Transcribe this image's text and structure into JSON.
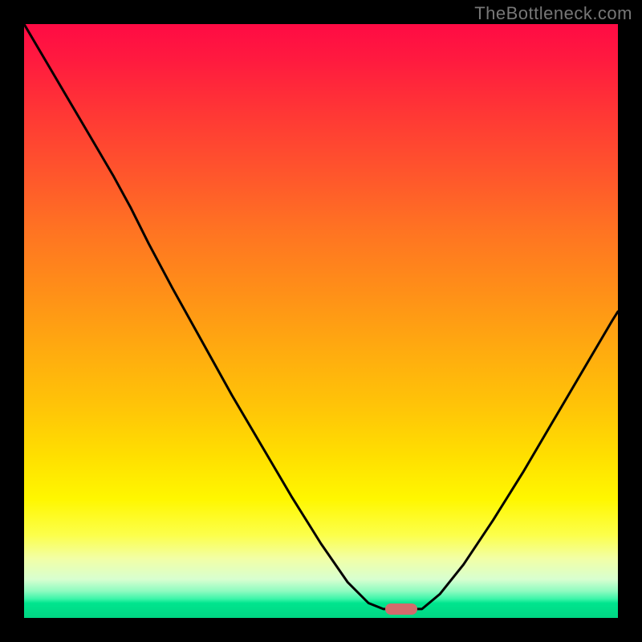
{
  "watermark": "TheBottleneck.com",
  "colors": {
    "background_outer": "#000000",
    "curve_stroke": "#000000",
    "marker_fill": "#d26b6c",
    "gradient_stops": [
      "#ff0b44",
      "#ff1a3f",
      "#ff3735",
      "#ff552c",
      "#ff7422",
      "#ff8f18",
      "#ffab0f",
      "#ffc607",
      "#ffe000",
      "#fff700",
      "#fcff4a",
      "#f2ffa6",
      "#d8ffd0",
      "#8dfbc0",
      "#3bf5a9",
      "#00e58e",
      "#00d683"
    ]
  },
  "chart_data": {
    "type": "line",
    "title": "",
    "xlabel": "",
    "ylabel": "",
    "xlim": [
      0,
      1
    ],
    "ylim": [
      0,
      1
    ],
    "note": "No axes or grid rendered; x and y are normalized to the plot area (0=left/bottom, 1=right/top). Single black curve descending from upper-left to a flat minimum near x≈0.60–0.67 then rising to the right. Small rounded marker sits on the flat minimum.",
    "series": [
      {
        "name": "bottleneck-curve",
        "points": [
          {
            "x": 0.0,
            "y": 1.0
          },
          {
            "x": 0.05,
            "y": 0.915
          },
          {
            "x": 0.1,
            "y": 0.83
          },
          {
            "x": 0.15,
            "y": 0.745
          },
          {
            "x": 0.18,
            "y": 0.69
          },
          {
            "x": 0.21,
            "y": 0.63
          },
          {
            "x": 0.25,
            "y": 0.555
          },
          {
            "x": 0.3,
            "y": 0.465
          },
          {
            "x": 0.35,
            "y": 0.375
          },
          {
            "x": 0.4,
            "y": 0.29
          },
          {
            "x": 0.45,
            "y": 0.205
          },
          {
            "x": 0.5,
            "y": 0.125
          },
          {
            "x": 0.545,
            "y": 0.06
          },
          {
            "x": 0.58,
            "y": 0.025
          },
          {
            "x": 0.605,
            "y": 0.015
          },
          {
            "x": 0.64,
            "y": 0.015
          },
          {
            "x": 0.67,
            "y": 0.015
          },
          {
            "x": 0.7,
            "y": 0.04
          },
          {
            "x": 0.74,
            "y": 0.09
          },
          {
            "x": 0.79,
            "y": 0.165
          },
          {
            "x": 0.84,
            "y": 0.245
          },
          {
            "x": 0.89,
            "y": 0.33
          },
          {
            "x": 0.94,
            "y": 0.415
          },
          {
            "x": 0.99,
            "y": 0.5
          },
          {
            "x": 1.0,
            "y": 0.516
          }
        ]
      }
    ],
    "marker": {
      "x": 0.635,
      "y": 0.015
    }
  }
}
